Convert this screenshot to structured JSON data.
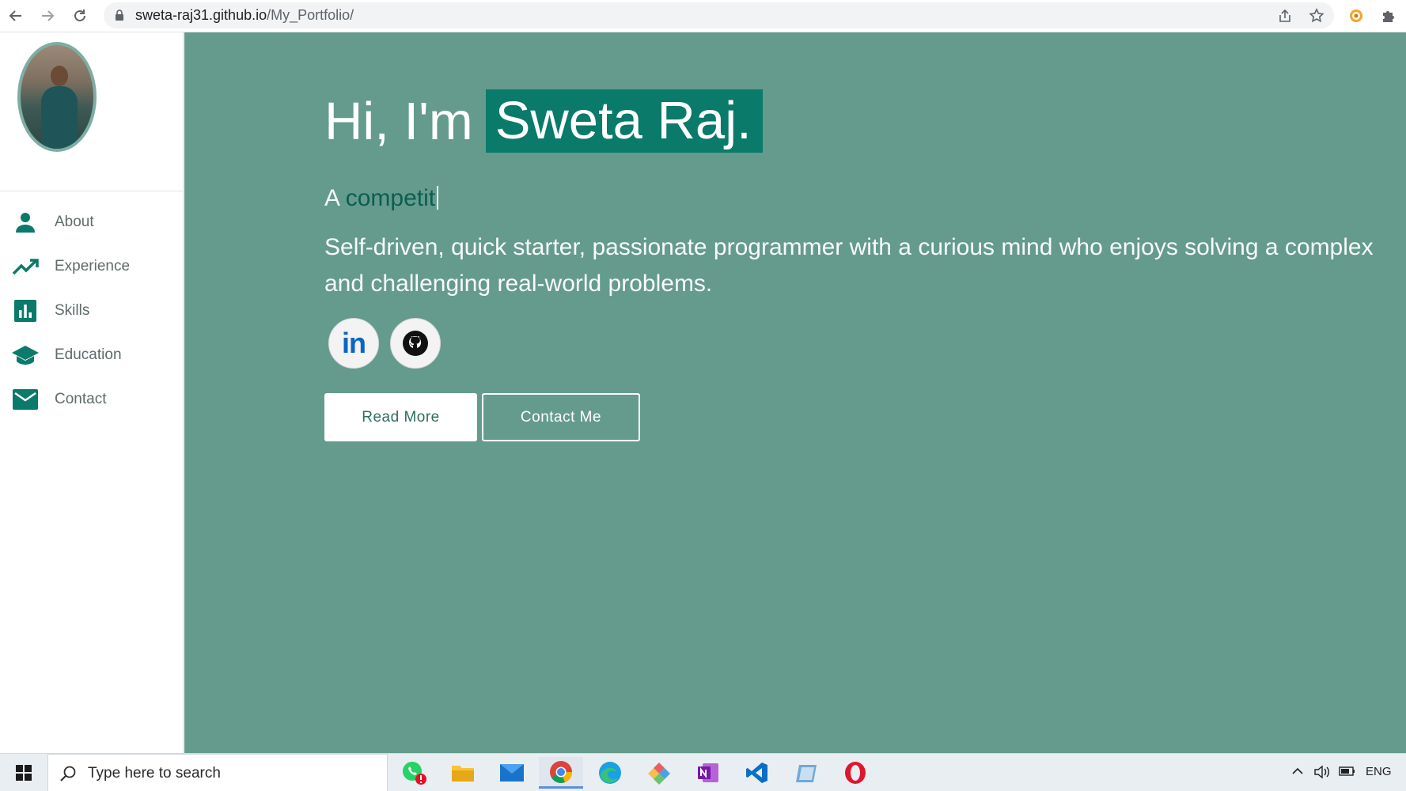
{
  "browser": {
    "url_host": "sweta-raj31.github.io",
    "url_path": "/My_Portfolio/"
  },
  "sidebar": {
    "items": [
      {
        "label": "About",
        "icon": "person-icon"
      },
      {
        "label": "Experience",
        "icon": "trending-up-icon"
      },
      {
        "label": "Skills",
        "icon": "bar-chart-icon"
      },
      {
        "label": "Education",
        "icon": "graduation-cap-icon"
      },
      {
        "label": "Contact",
        "icon": "mail-icon"
      }
    ]
  },
  "hero": {
    "greeting": "Hi, I'm",
    "name": "Sweta Raj.",
    "typed_prefix": "A",
    "typed_word": "competit",
    "bio": "Self-driven, quick starter, passionate programmer with a curious mind who enjoys solving a complex and challenging real-world problems.",
    "linkedin_label": "in",
    "read_more": "Read More",
    "contact_me": "Contact Me"
  },
  "taskbar": {
    "search_placeholder": "Type here to search",
    "language": "ENG"
  },
  "colors": {
    "hero_bg": "#659b8d",
    "accent": "#0a7a6a",
    "sidebar_icon": "#0a7a6a"
  }
}
